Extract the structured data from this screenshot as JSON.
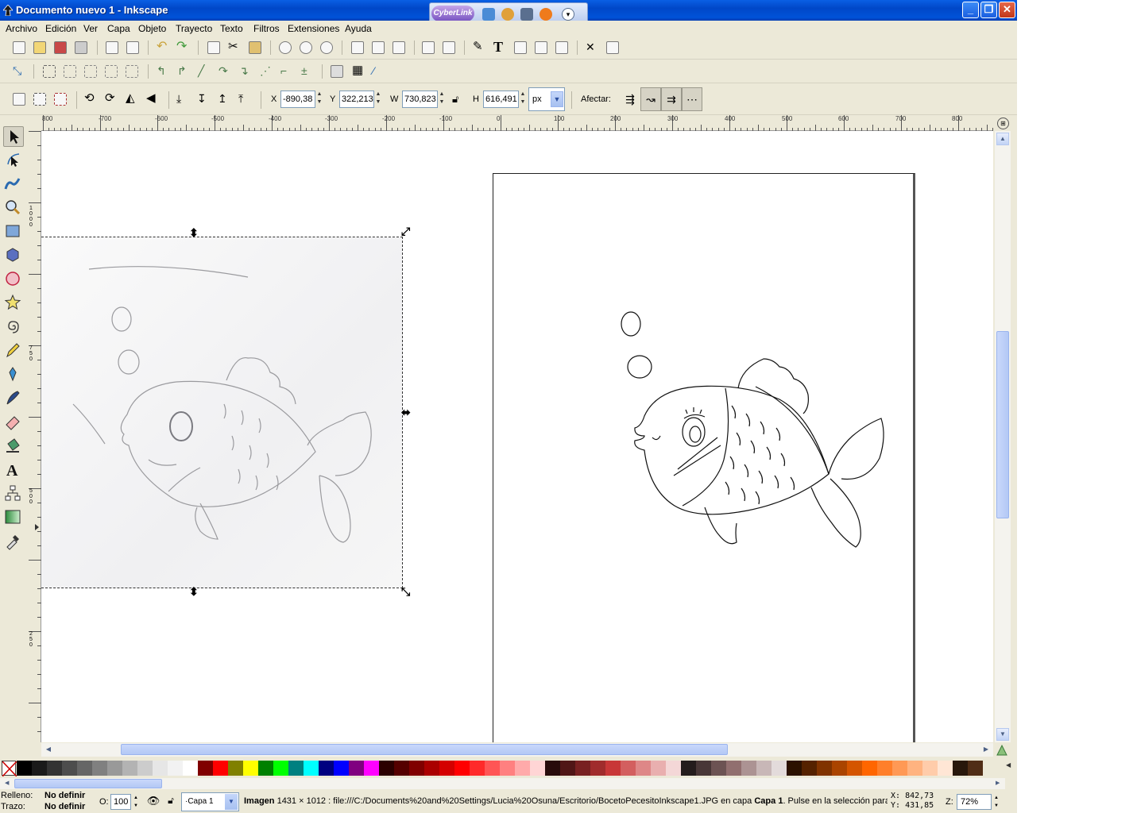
{
  "window": {
    "title": "Documento nuevo 1 - Inkscape",
    "minimize": "_",
    "restore": "❐",
    "close": "✕"
  },
  "cyberlink": {
    "label": "CyberLink"
  },
  "menu": [
    "Archivo",
    "Edición",
    "Ver",
    "Capa",
    "Objeto",
    "Trayecto",
    "Texto",
    "Filtros",
    "Extensiones",
    "Ayuda"
  ],
  "selectbar": {
    "x_label": "X",
    "x_value": "-890,38",
    "y_label": "Y",
    "y_value": "322,213",
    "w_label": "W",
    "w_value": "730,823",
    "h_label": "H",
    "h_value": "616,491",
    "unit": "px",
    "affect_label": "Afectar:"
  },
  "ruler_h_ticks": [
    "800",
    "-700",
    "-600",
    "-500",
    "-400",
    "-300",
    "-200",
    "-100",
    "0",
    "100",
    "200",
    "300",
    "400",
    "500",
    "600",
    "700",
    "800"
  ],
  "ruler_v_ticks": [
    "1000",
    "750",
    "500",
    "250"
  ],
  "status": {
    "fill_label": "Relleno:",
    "fill_value": "No definir",
    "stroke_label": "Trazo:",
    "stroke_value": "No definir",
    "opacity_label": "O:",
    "opacity_value": "100",
    "layer": "·Capa 1",
    "message_type": "Imagen",
    "message_body": " 1431 × 1012 : file:///C:/Documents%20and%20Settings/Lucia%20Osuna/Escritorio/BocetoPecesitoInkscape1.JPG en capa ",
    "message_layer": "Capa 1",
    "message_tail": ". Pulse en la selección para",
    "cursor_x_label": "X:",
    "cursor_x": "842,73",
    "cursor_y_label": "Y:",
    "cursor_y": "431,85",
    "zoom_label": "Z:",
    "zoom_value": "72%"
  },
  "palette": [
    "#000000",
    "#1a1a1a",
    "#333333",
    "#4d4d4d",
    "#666666",
    "#808080",
    "#999999",
    "#b3b3b3",
    "#cccccc",
    "#e6e6e6",
    "#f2f2f2",
    "#ffffff",
    "#800000",
    "#ff0000",
    "#808000",
    "#ffff00",
    "#008000",
    "#00ff00",
    "#008080",
    "#00ffff",
    "#000080",
    "#0000ff",
    "#800080",
    "#ff00ff",
    "#2b0000",
    "#550000",
    "#800000",
    "#aa0000",
    "#d40000",
    "#ff0000",
    "#ff2a2a",
    "#ff5555",
    "#ff8080",
    "#ffaaaa",
    "#ffd5d5",
    "#280b0b",
    "#501616",
    "#782121",
    "#a02c2c",
    "#c83737",
    "#d35f5f",
    "#de8787",
    "#e9afaf",
    "#f4d7d7",
    "#241c1c",
    "#483737",
    "#6c5353",
    "#916f6f",
    "#ac9393",
    "#c8b7b7",
    "#e3dbdb",
    "#2b1100",
    "#552200",
    "#803300",
    "#aa4400",
    "#d45500",
    "#ff6600",
    "#ff7f2a",
    "#ff9955",
    "#ffb380",
    "#ffccaa",
    "#ffe6d5",
    "#28170b",
    "#502d16"
  ]
}
